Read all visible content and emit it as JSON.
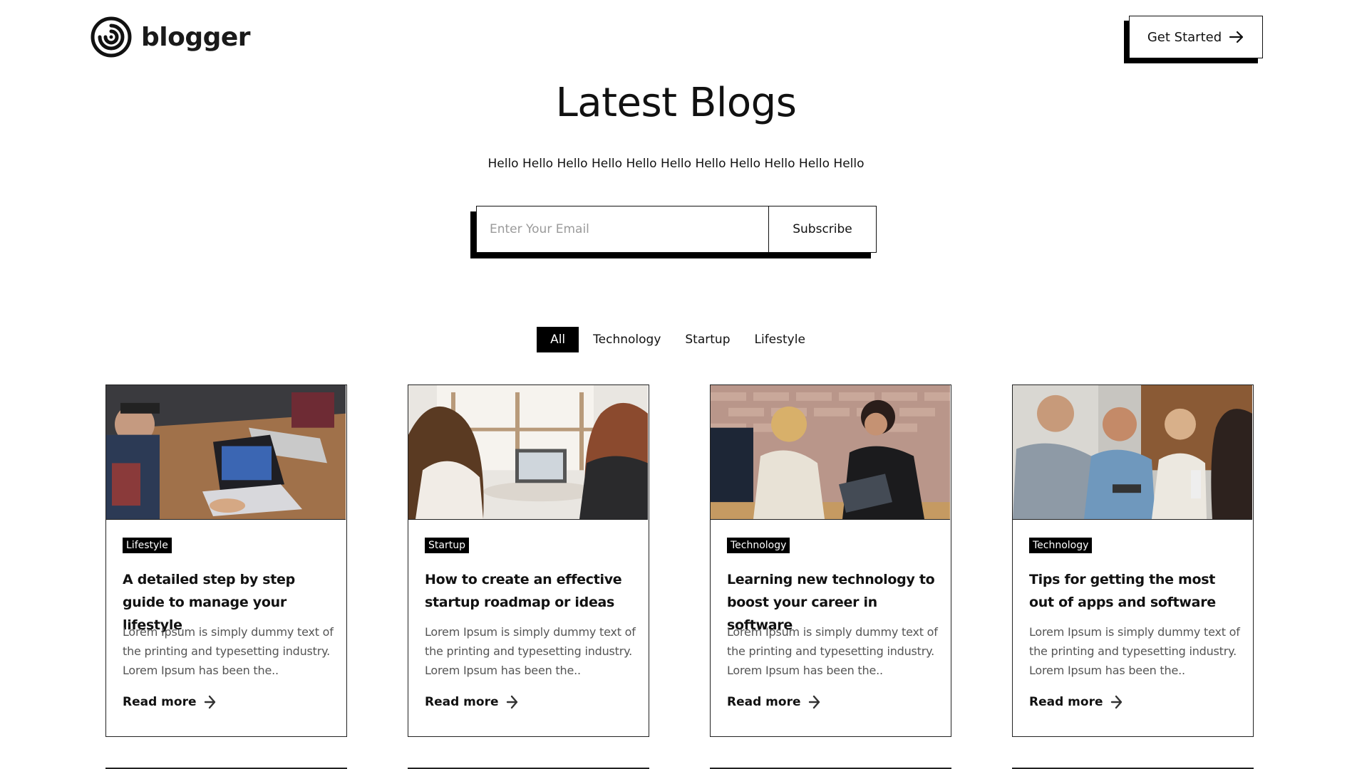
{
  "brand": {
    "name": "blogger",
    "logo_icon": "concentric-rings-logo-icon"
  },
  "header": {
    "cta_label": "Get Started",
    "cta_icon": "arrow-right-icon"
  },
  "hero": {
    "title": "Latest Blogs",
    "subtitle": "Hello Hello Hello Hello Hello Hello Hello Hello Hello Hello Hello"
  },
  "subscribe": {
    "placeholder": "Enter Your Email",
    "value": "",
    "button_label": "Subscribe"
  },
  "filters": {
    "active": "All",
    "tabs": [
      {
        "label": "All"
      },
      {
        "label": "Technology"
      },
      {
        "label": "Startup"
      },
      {
        "label": "Lifestyle"
      }
    ]
  },
  "posts": [
    {
      "category": "Lifestyle",
      "title": "A detailed step by step guide to manage your lifestyle",
      "excerpt": "Lorem Ipsum is simply dummy text of the printing and typesetting industry. Lorem Ipsum has been the..",
      "cta": "Read more",
      "image": "people-working-laptop-photo"
    },
    {
      "category": "Startup",
      "title": "How to create an effective startup roadmap or ideas",
      "excerpt": "Lorem Ipsum is simply dummy text of the printing and typesetting industry. Lorem Ipsum has been the..",
      "cta": "Read more",
      "image": "two-women-at-laptop-photo"
    },
    {
      "category": "Technology",
      "title": "Learning new technology to boost your career in software",
      "excerpt": "Lorem Ipsum is simply dummy text of the printing and typesetting industry. Lorem Ipsum has been the..",
      "cta": "Read more",
      "image": "women-meeting-tablet-photo"
    },
    {
      "category": "Technology",
      "title": "Tips for getting the most out of apps and software",
      "excerpt": "Lorem Ipsum is simply dummy text of the printing and typesetting industry. Lorem Ipsum has been the..",
      "cta": "Read more",
      "image": "group-with-phones-photo"
    }
  ],
  "colors": {
    "ink": "#111111",
    "muted": "#555555",
    "shadow": "#000000",
    "background": "#ffffff"
  }
}
